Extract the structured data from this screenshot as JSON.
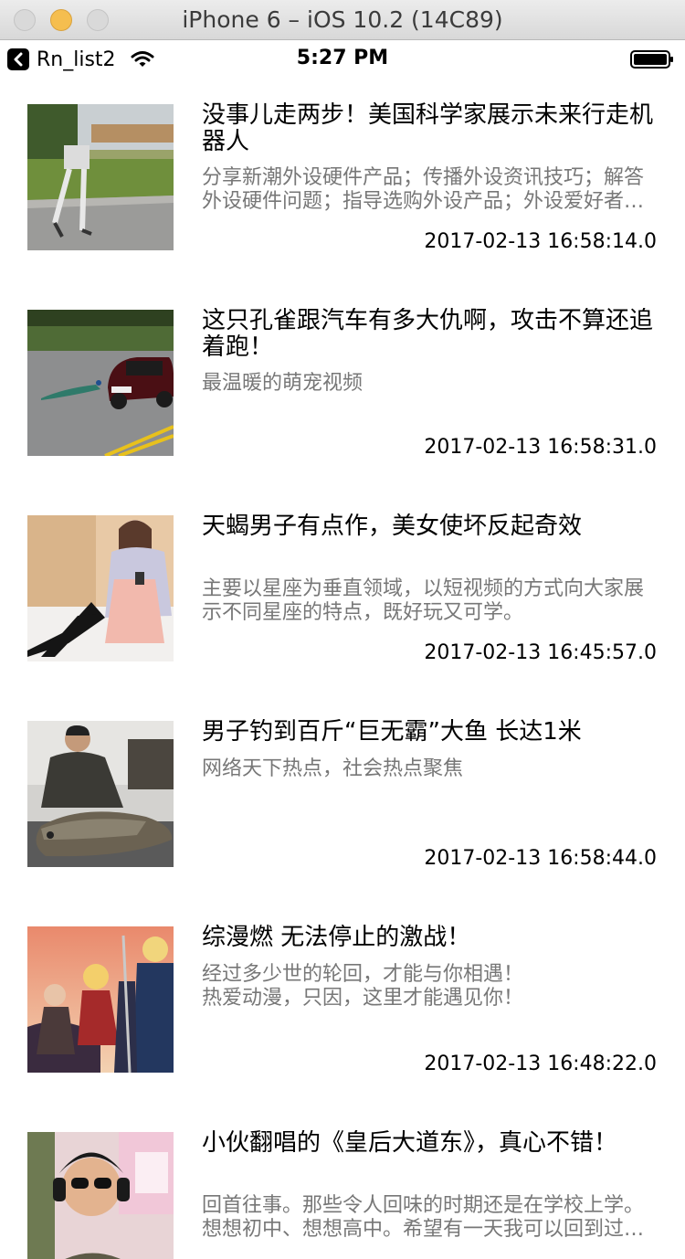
{
  "window": {
    "title": "iPhone 6 – iOS 10.2 (14C89)"
  },
  "statusbar": {
    "back_app_label": "Rn_list2",
    "time": "5:27 PM"
  },
  "items": [
    {
      "title": "没事儿走两步！美国科学家展示未来行走机器人",
      "desc": "分享新潮外设硬件产品；传播外设资讯技巧；解答外设硬件问题；指导选购外设产品；外设爱好者的聚集地。",
      "time": "2017-02-13 16:58:14.0"
    },
    {
      "title": "这只孔雀跟汽车有多大仇啊，攻击不算还追着跑！",
      "desc": "最温暖的萌宠视频",
      "time": "2017-02-13 16:58:31.0"
    },
    {
      "title": "天蝎男子有点作，美女使坏反起奇效",
      "desc": "主要以星座为垂直领域，以短视频的方式向大家展示不同星座的特点，既好玩又可学。",
      "time": "2017-02-13 16:45:57.0"
    },
    {
      "title": "男子钓到百斤“巨无霸”大鱼 长达1米",
      "desc": "网络天下热点，社会热点聚焦",
      "time": "2017-02-13 16:58:44.0"
    },
    {
      "title": "综漫燃 无法停止的激战！",
      "desc": "经过多少世的轮回，才能与你相遇！\n热爱动漫，只因，这里才能遇见你！",
      "time": "2017-02-13 16:48:22.0"
    },
    {
      "title": "小伙翻唱的《皇后大道东》，真心不错！",
      "desc": "回首往事。那些令人回味的时期还是在学校上学。想想初中、想想高中。希望有一天我可以回到过去。",
      "time": ""
    }
  ],
  "colors": {
    "title_text": "#000000",
    "desc_text": "#777777",
    "minimize_button": "#f5be4f"
  }
}
